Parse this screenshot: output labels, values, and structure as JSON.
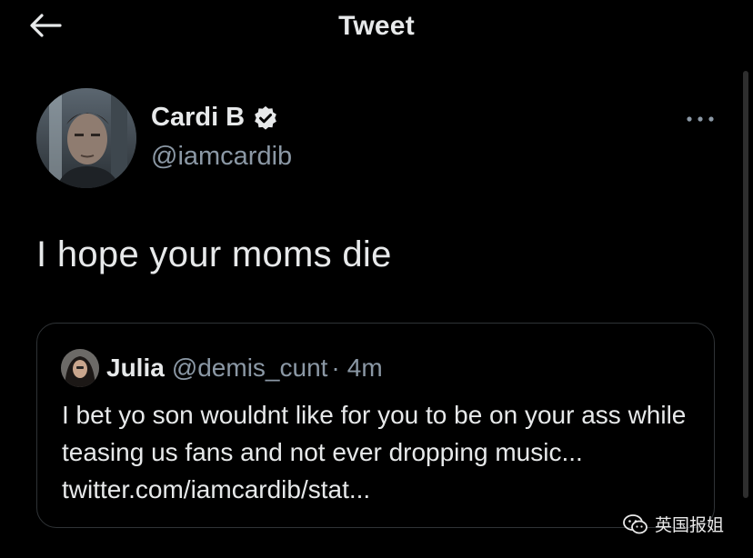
{
  "header": {
    "title": "Tweet",
    "back_icon": "arrow-left-icon"
  },
  "tweet": {
    "author": {
      "name": "Cardi B",
      "handle": "@iamcardib",
      "verified": true,
      "verified_icon": "verified-badge-icon",
      "avatar": "avatar"
    },
    "more_icon": "more-options-icon",
    "text": "I hope your moms die"
  },
  "quote": {
    "name": "Julia",
    "handle": "@demis_cunt",
    "separator": "·",
    "time": "4m",
    "text": "I bet yo son wouldnt like for you to be on your ass while teasing us fans and not ever dropping music... twitter.com/iamcardib/stat..."
  },
  "watermark": {
    "icon": "wechat-icon",
    "text": "英国报姐"
  },
  "colors": {
    "background": "#000000",
    "primary_text": "#e7e9ea",
    "secondary_text": "#8b98a5",
    "border": "#2f3336",
    "verified_badge": "#e7e9ea"
  }
}
